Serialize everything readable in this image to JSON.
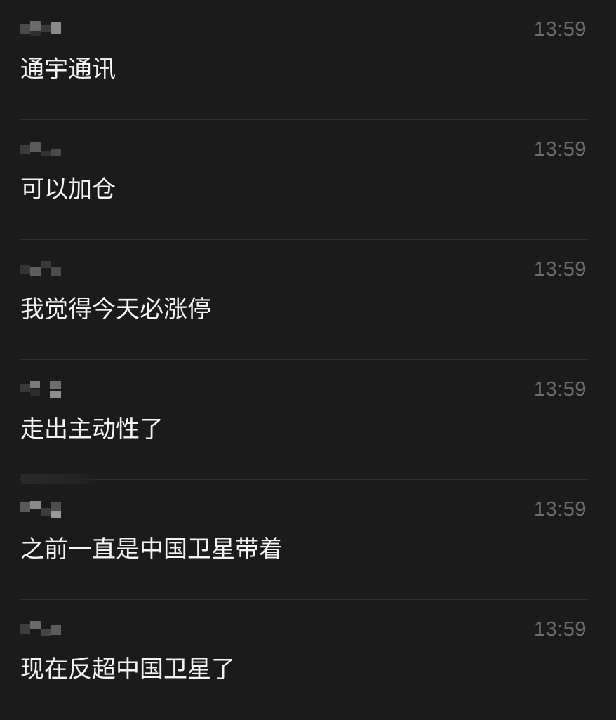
{
  "messages": [
    {
      "time": "13:59",
      "text": "通宇通讯"
    },
    {
      "time": "13:59",
      "text": "可以加仓"
    },
    {
      "time": "13:59",
      "text": "我觉得今天必涨停"
    },
    {
      "time": "13:59",
      "text": "走出主动性了"
    },
    {
      "time": "13:59",
      "text": "之前一直是中国卫星带着"
    },
    {
      "time": "13:59",
      "text": "现在反超中国卫星了"
    }
  ],
  "colors": {
    "background": "#1b1b1b",
    "text": "#f4f4f4",
    "time": "#6d6d6d",
    "separator": "#303030"
  }
}
